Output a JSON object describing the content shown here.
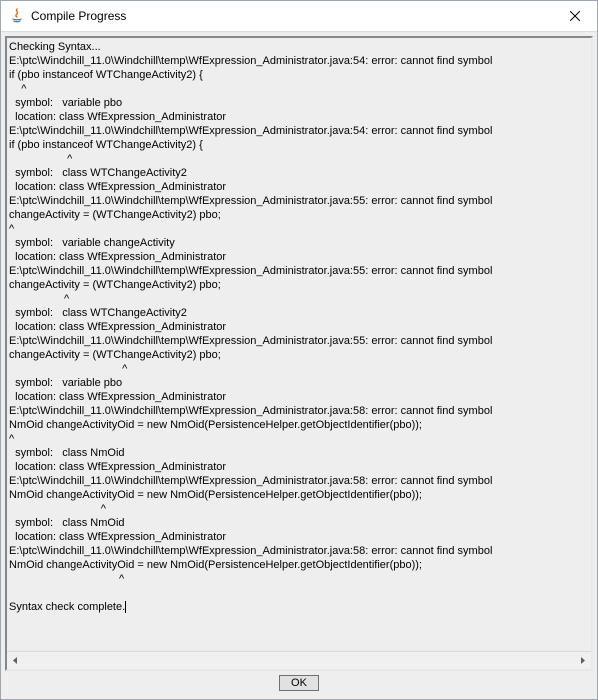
{
  "window": {
    "title": "Compile Progress"
  },
  "log": {
    "lines": [
      "Checking Syntax...",
      "E:\\ptc\\Windchill_11.0\\Windchill\\temp\\WfExpression_Administrator.java:54: error: cannot find symbol",
      "if (pbo instanceof WTChangeActivity2) {",
      "    ^",
      "  symbol:   variable pbo",
      "  location: class WfExpression_Administrator",
      "E:\\ptc\\Windchill_11.0\\Windchill\\temp\\WfExpression_Administrator.java:54: error: cannot find symbol",
      "if (pbo instanceof WTChangeActivity2) {",
      "                   ^",
      "  symbol:   class WTChangeActivity2",
      "  location: class WfExpression_Administrator",
      "E:\\ptc\\Windchill_11.0\\Windchill\\temp\\WfExpression_Administrator.java:55: error: cannot find symbol",
      "changeActivity = (WTChangeActivity2) pbo;",
      "^",
      "  symbol:   variable changeActivity",
      "  location: class WfExpression_Administrator",
      "E:\\ptc\\Windchill_11.0\\Windchill\\temp\\WfExpression_Administrator.java:55: error: cannot find symbol",
      "changeActivity = (WTChangeActivity2) pbo;",
      "                  ^",
      "  symbol:   class WTChangeActivity2",
      "  location: class WfExpression_Administrator",
      "E:\\ptc\\Windchill_11.0\\Windchill\\temp\\WfExpression_Administrator.java:55: error: cannot find symbol",
      "changeActivity = (WTChangeActivity2) pbo;",
      "                                     ^",
      "  symbol:   variable pbo",
      "  location: class WfExpression_Administrator",
      "E:\\ptc\\Windchill_11.0\\Windchill\\temp\\WfExpression_Administrator.java:58: error: cannot find symbol",
      "NmOid changeActivityOid = new NmOid(PersistenceHelper.getObjectIdentifier(pbo));",
      "^",
      "  symbol:   class NmOid",
      "  location: class WfExpression_Administrator",
      "E:\\ptc\\Windchill_11.0\\Windchill\\temp\\WfExpression_Administrator.java:58: error: cannot find symbol",
      "NmOid changeActivityOid = new NmOid(PersistenceHelper.getObjectIdentifier(pbo));",
      "                              ^",
      "  symbol:   class NmOid",
      "  location: class WfExpression_Administrator",
      "E:\\ptc\\Windchill_11.0\\Windchill\\temp\\WfExpression_Administrator.java:58: error: cannot find symbol",
      "NmOid changeActivityOid = new NmOid(PersistenceHelper.getObjectIdentifier(pbo));",
      "                                    ^",
      "",
      "Syntax check complete."
    ]
  },
  "buttons": {
    "ok_label": "OK"
  }
}
